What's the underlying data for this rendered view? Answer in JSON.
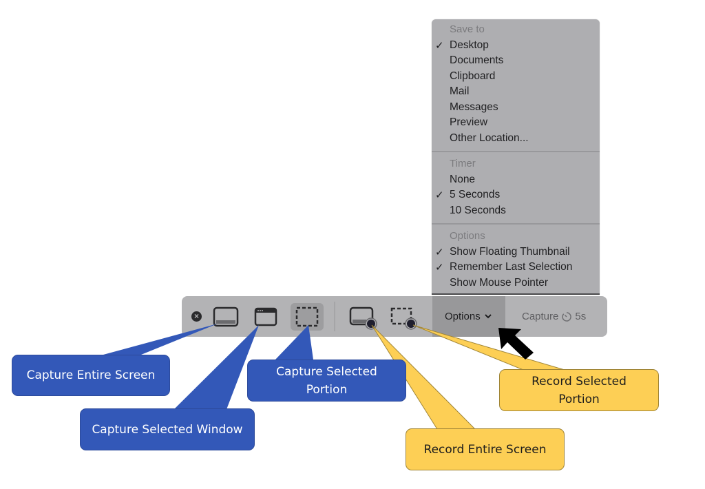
{
  "menu": {
    "sections": [
      {
        "header": "Save to",
        "items": [
          {
            "label": "Desktop",
            "checked": true
          },
          {
            "label": "Documents",
            "checked": false
          },
          {
            "label": "Clipboard",
            "checked": false
          },
          {
            "label": "Mail",
            "checked": false
          },
          {
            "label": "Messages",
            "checked": false
          },
          {
            "label": "Preview",
            "checked": false
          },
          {
            "label": "Other Location...",
            "checked": false
          }
        ]
      },
      {
        "header": "Timer",
        "items": [
          {
            "label": "None",
            "checked": false
          },
          {
            "label": "5 Seconds",
            "checked": true
          },
          {
            "label": "10 Seconds",
            "checked": false
          }
        ]
      },
      {
        "header": "Options",
        "items": [
          {
            "label": "Show Floating Thumbnail",
            "checked": true
          },
          {
            "label": "Remember Last Selection",
            "checked": true
          },
          {
            "label": "Show Mouse Pointer",
            "checked": false
          }
        ]
      }
    ],
    "check_glyph": "✓"
  },
  "toolbar": {
    "close_icon": "close-circle-icon",
    "buttons": [
      {
        "id": "capture-entire-screen",
        "icon": "screen-icon",
        "selected": false
      },
      {
        "id": "capture-selected-window",
        "icon": "window-icon",
        "selected": false
      },
      {
        "id": "capture-selected-portion",
        "icon": "dashed-selection-icon",
        "selected": true
      },
      {
        "id": "record-entire-screen",
        "icon": "screen-record-icon",
        "selected": false
      },
      {
        "id": "record-selected-portion",
        "icon": "dashed-selection-record-icon",
        "selected": false
      }
    ],
    "options_label": "Options",
    "options_chevron": "⌄",
    "capture_label": "Capture",
    "timer_label": "5s"
  },
  "callouts": {
    "capture_entire_screen": "Capture Entire Screen",
    "capture_selected_window": "Capture Selected Window",
    "capture_selected_portion": "Capture Selected Portion",
    "record_entire_screen": "Record Entire Screen",
    "record_selected_portion": "Record Selected Portion"
  },
  "colors": {
    "blue_callout": "#3358b8",
    "yellow_callout": "#fdcf55",
    "menu_bg": "#aeaeb1",
    "toolbar_bg": "#b3b3b5"
  }
}
